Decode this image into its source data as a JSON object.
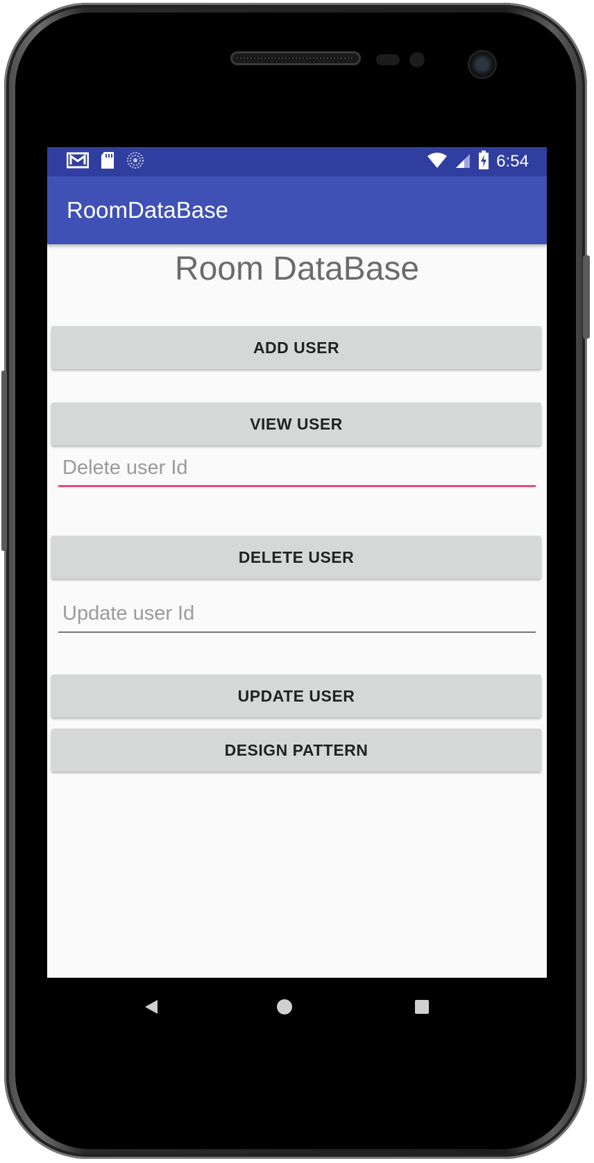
{
  "status_bar": {
    "time": "6:54",
    "left_icons": [
      "gmail-icon",
      "sd-card-icon",
      "sync-icon"
    ],
    "right_icons": [
      "wifi-icon",
      "signal-icon",
      "battery-charging-icon"
    ]
  },
  "app_bar": {
    "title": "RoomDataBase"
  },
  "main": {
    "heading": "Room DataBase",
    "add_user_label": "ADD USER",
    "view_user_label": "VIEW USER",
    "delete_field_placeholder": "Delete user Id",
    "delete_user_label": "DELETE USER",
    "update_field_placeholder": "Update user Id",
    "update_user_label": "UPDATE USER",
    "design_pattern_label": "DESIGN PATTERN"
  },
  "nav_bar": {
    "buttons": [
      "back-icon",
      "home-icon",
      "recents-icon"
    ]
  },
  "colors": {
    "status_bar": "#303f9f",
    "app_bar": "#3f51b5",
    "accent": "#e84a7f",
    "button": "#d6d7d7",
    "background": "#fafafa"
  }
}
